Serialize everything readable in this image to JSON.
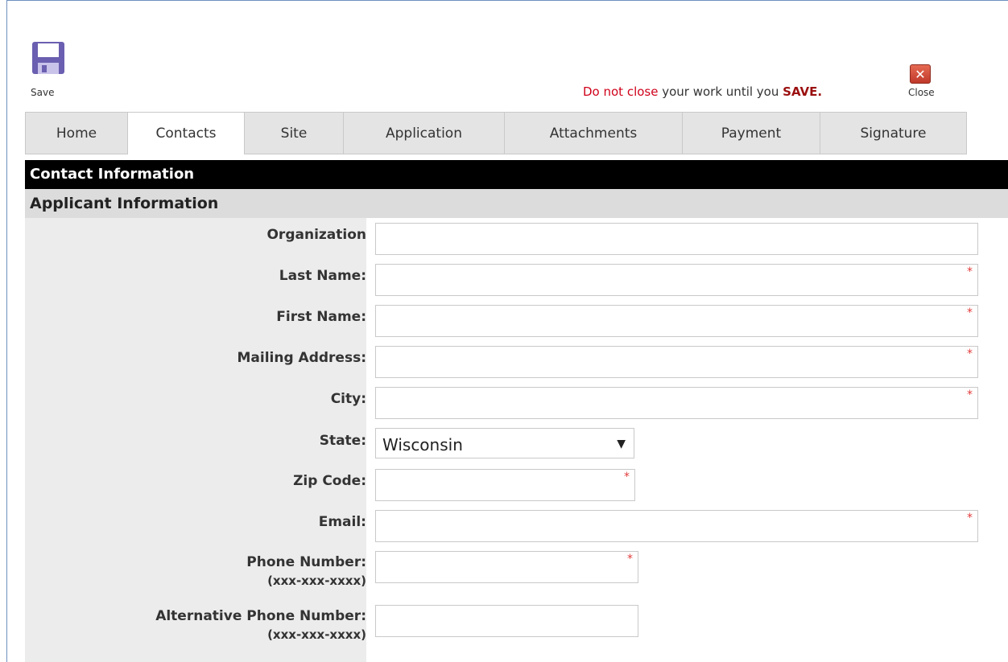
{
  "toolbar": {
    "save_label": "Save",
    "close_label": "Close",
    "notice_part1": "Do not close",
    "notice_part2": " your work until you ",
    "notice_part3": "SAVE.",
    "close_glyph": "✕"
  },
  "tabs": [
    {
      "label": "Home",
      "active": false
    },
    {
      "label": "Contacts",
      "active": true
    },
    {
      "label": "Site",
      "active": false
    },
    {
      "label": "Application",
      "active": false
    },
    {
      "label": "Attachments",
      "active": false
    },
    {
      "label": "Payment",
      "active": false
    },
    {
      "label": "Signature",
      "active": false
    }
  ],
  "section": {
    "title": "Contact Information",
    "subtitle": "Applicant Information"
  },
  "form": {
    "organization_label": "Organization",
    "last_name_label": "Last Name:",
    "first_name_label": "First Name:",
    "mailing_address_label": "Mailing Address:",
    "city_label": "City:",
    "state_label": "State:",
    "state_value": "Wisconsin",
    "zip_label": "Zip Code:",
    "email_label": "Email:",
    "phone_label": "Phone Number:",
    "phone_hint": "(xxx-xxx-xxxx)",
    "alt_phone_label": "Alternative Phone Number:",
    "alt_phone_hint": "(xxx-xxx-xxxx)",
    "required_marker": "*",
    "dropdown_arrow": "▼"
  },
  "colors": {
    "notice_red": "#d0021b",
    "required_red": "#e23b3b",
    "header_black": "#000000",
    "save_icon": "#6a5fb0"
  },
  "icons": {
    "save": "floppy-disk-icon",
    "close": "close-x-icon"
  }
}
